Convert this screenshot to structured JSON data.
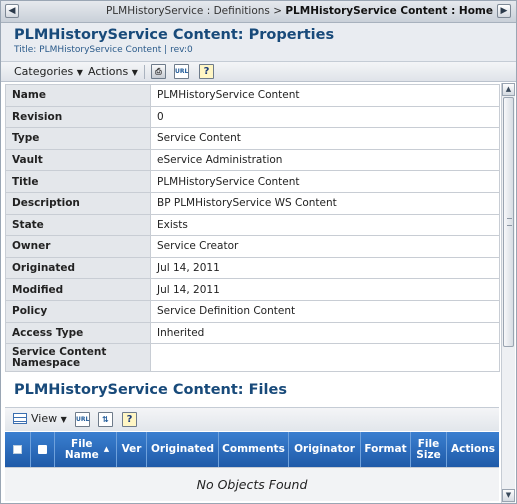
{
  "breadcrumb": {
    "back_icon": "chevron-left-icon",
    "forward_icon": "chevron-right-icon",
    "path": "PLMHistoryService : Definitions > ",
    "current": "PLMHistoryService Content : Home"
  },
  "header": {
    "title": "PLMHistoryService Content: Properties",
    "subtitle": "Title: PLMHistoryService Content | rev:0"
  },
  "toolbar": {
    "categories_label": "Categories",
    "actions_label": "Actions",
    "icons": [
      "printer-icon",
      "url-icon",
      "help-icon"
    ]
  },
  "properties": [
    {
      "label": "Name",
      "value": "PLMHistoryService Content"
    },
    {
      "label": "Revision",
      "value": "0"
    },
    {
      "label": "Type",
      "value": "Service Content"
    },
    {
      "label": "Vault",
      "value": "eService Administration"
    },
    {
      "label": "Title",
      "value": "PLMHistoryService Content"
    },
    {
      "label": "Description",
      "value": "BP PLMHistoryService WS Content"
    },
    {
      "label": "State",
      "value": "Exists"
    },
    {
      "label": "Owner",
      "value": " Service Creator"
    },
    {
      "label": "Originated",
      "value": "Jul 14, 2011"
    },
    {
      "label": "Modified",
      "value": "Jul 14, 2011"
    },
    {
      "label": "Policy",
      "value": "Service Definition Content"
    },
    {
      "label": "Access Type",
      "value": "Inherited"
    },
    {
      "label": "Service Content Namespace",
      "value": ""
    }
  ],
  "files": {
    "title": "PLMHistoryService Content: Files",
    "toolbar": {
      "view_label": "View",
      "icons": [
        "table-view-icon",
        "url-icon",
        "sort-icon",
        "help-icon"
      ]
    },
    "columns": [
      "File Name",
      "Ver",
      "Originated",
      "Comments",
      "Originator",
      "Format",
      "File Size",
      "Actions"
    ],
    "empty_message": "No Objects Found"
  }
}
